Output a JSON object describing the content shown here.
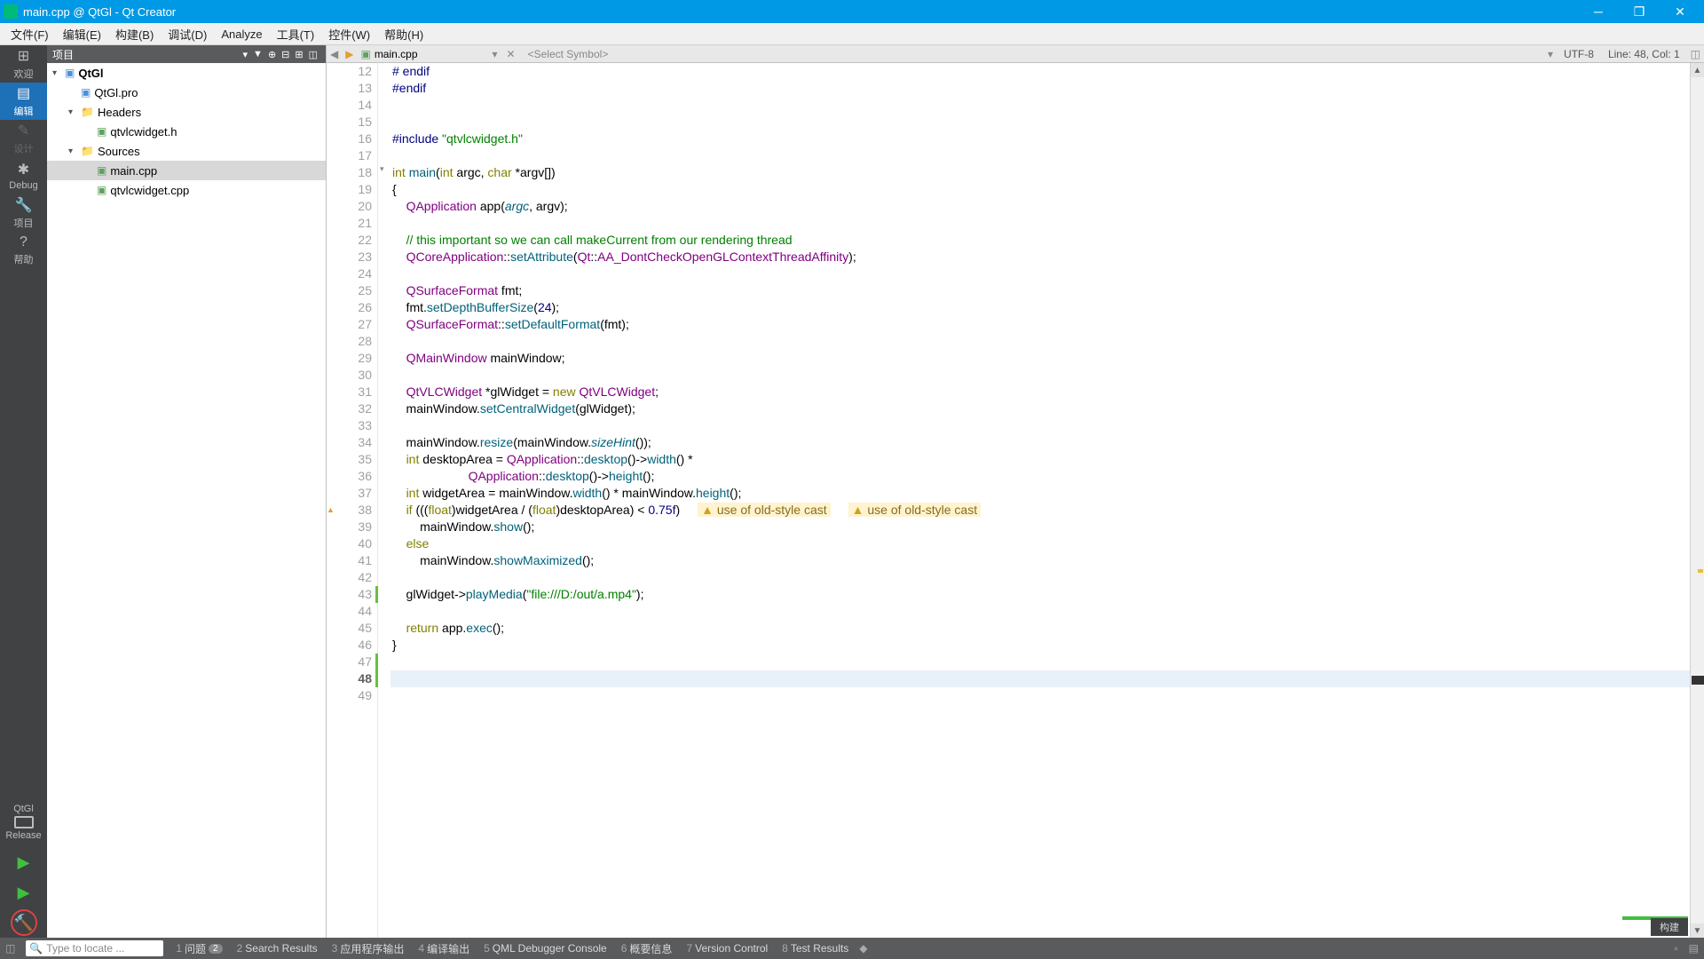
{
  "title": "main.cpp @ QtGl - Qt Creator",
  "menu": [
    "文件(F)",
    "编辑(E)",
    "构建(B)",
    "调试(D)",
    "Analyze",
    "工具(T)",
    "控件(W)",
    "帮助(H)"
  ],
  "modes": [
    {
      "icon": "⊞",
      "label": "欢迎"
    },
    {
      "icon": "▤",
      "label": "编辑"
    },
    {
      "icon": "✎",
      "label": "设计"
    },
    {
      "icon": "✱",
      "label": "Debug"
    },
    {
      "icon": "🔧",
      "label": "项目"
    },
    {
      "icon": "?",
      "label": "帮助"
    }
  ],
  "kit": {
    "name": "QtGl",
    "config": "Release"
  },
  "proj_header": "项目",
  "tree": [
    {
      "depth": 0,
      "twist": "▾",
      "ico": "proj",
      "label": "QtGl",
      "bold": true
    },
    {
      "depth": 1,
      "twist": "",
      "ico": "proj",
      "label": "QtGl.pro"
    },
    {
      "depth": 1,
      "twist": "▾",
      "ico": "folder",
      "label": "Headers"
    },
    {
      "depth": 2,
      "twist": "",
      "ico": "hdr",
      "label": "qtvlcwidget.h"
    },
    {
      "depth": 1,
      "twist": "▾",
      "ico": "folder",
      "label": "Sources"
    },
    {
      "depth": 2,
      "twist": "",
      "ico": "cpp",
      "label": "main.cpp",
      "sel": true
    },
    {
      "depth": 2,
      "twist": "",
      "ico": "cpp",
      "label": "qtvlcwidget.cpp"
    }
  ],
  "tab": {
    "file": "main.cpp",
    "symbol": "<Select Symbol>",
    "enc": "UTF-8",
    "pos": "Line: 48, Col: 1"
  },
  "first_line": 12,
  "cur_line": 48,
  "warn_lines": [
    38
  ],
  "green_ranges": [
    [
      43,
      43
    ],
    [
      47,
      48
    ]
  ],
  "warn_text": "use of old-style cast",
  "code": [
    {
      "t": [
        {
          "c": "pre",
          "s": "# endif"
        }
      ]
    },
    {
      "t": [
        {
          "c": "pre",
          "s": "#endif"
        }
      ]
    },
    {
      "t": []
    },
    {
      "t": []
    },
    {
      "t": [
        {
          "c": "pre",
          "s": "#include "
        },
        {
          "c": "str",
          "s": "\"qtvlcwidget.h\""
        }
      ]
    },
    {
      "t": []
    },
    {
      "t": [
        {
          "c": "kw",
          "s": "int"
        },
        {
          "s": " "
        },
        {
          "c": "fn",
          "s": "main"
        },
        {
          "s": "("
        },
        {
          "c": "kw",
          "s": "int"
        },
        {
          "s": " argc, "
        },
        {
          "c": "kw",
          "s": "char"
        },
        {
          "s": " *argv[])"
        }
      ],
      "fold": "▾"
    },
    {
      "t": [
        {
          "s": "{"
        }
      ]
    },
    {
      "t": [
        {
          "s": "    "
        },
        {
          "c": "typ",
          "s": "QApplication"
        },
        {
          "s": " app("
        },
        {
          "c": "fni",
          "s": "argc"
        },
        {
          "s": ", argv);"
        }
      ]
    },
    {
      "t": []
    },
    {
      "t": [
        {
          "s": "    "
        },
        {
          "c": "cmt",
          "s": "// this important so we can call makeCurrent from our rendering thread"
        }
      ]
    },
    {
      "t": [
        {
          "s": "    "
        },
        {
          "c": "typ",
          "s": "QCoreApplication"
        },
        {
          "s": "::"
        },
        {
          "c": "fn",
          "s": "setAttribute"
        },
        {
          "s": "("
        },
        {
          "c": "typ",
          "s": "Qt"
        },
        {
          "s": "::"
        },
        {
          "c": "enm",
          "s": "AA_DontCheckOpenGLContextThreadAffinity"
        },
        {
          "s": ");"
        }
      ]
    },
    {
      "t": []
    },
    {
      "t": [
        {
          "s": "    "
        },
        {
          "c": "typ",
          "s": "QSurfaceFormat"
        },
        {
          "s": " fmt;"
        }
      ]
    },
    {
      "t": [
        {
          "s": "    fmt."
        },
        {
          "c": "fn",
          "s": "setDepthBufferSize"
        },
        {
          "s": "("
        },
        {
          "c": "num",
          "s": "24"
        },
        {
          "s": ");"
        }
      ]
    },
    {
      "t": [
        {
          "s": "    "
        },
        {
          "c": "typ",
          "s": "QSurfaceFormat"
        },
        {
          "s": "::"
        },
        {
          "c": "fn",
          "s": "setDefaultFormat"
        },
        {
          "s": "(fmt);"
        }
      ]
    },
    {
      "t": []
    },
    {
      "t": [
        {
          "s": "    "
        },
        {
          "c": "typ",
          "s": "QMainWindow"
        },
        {
          "s": " mainWindow;"
        }
      ]
    },
    {
      "t": []
    },
    {
      "t": [
        {
          "s": "    "
        },
        {
          "c": "typ",
          "s": "QtVLCWidget"
        },
        {
          "s": " *glWidget = "
        },
        {
          "c": "kw",
          "s": "new"
        },
        {
          "s": " "
        },
        {
          "c": "typ",
          "s": "QtVLCWidget"
        },
        {
          "s": ";"
        }
      ]
    },
    {
      "t": [
        {
          "s": "    mainWindow."
        },
        {
          "c": "fn",
          "s": "setCentralWidget"
        },
        {
          "s": "(glWidget);"
        }
      ]
    },
    {
      "t": []
    },
    {
      "t": [
        {
          "s": "    mainWindow."
        },
        {
          "c": "fn",
          "s": "resize"
        },
        {
          "s": "(mainWindow."
        },
        {
          "c": "fni",
          "s": "sizeHint"
        },
        {
          "s": "());"
        }
      ]
    },
    {
      "t": [
        {
          "s": "    "
        },
        {
          "c": "kw",
          "s": "int"
        },
        {
          "s": " desktopArea = "
        },
        {
          "c": "typ",
          "s": "QApplication"
        },
        {
          "s": "::"
        },
        {
          "c": "fn",
          "s": "desktop"
        },
        {
          "s": "()->"
        },
        {
          "c": "fn",
          "s": "width"
        },
        {
          "s": "() *"
        }
      ]
    },
    {
      "t": [
        {
          "s": "                      "
        },
        {
          "c": "typ",
          "s": "QApplication"
        },
        {
          "s": "::"
        },
        {
          "c": "fn",
          "s": "desktop"
        },
        {
          "s": "()->"
        },
        {
          "c": "fn",
          "s": "height"
        },
        {
          "s": "();"
        }
      ]
    },
    {
      "t": [
        {
          "s": "    "
        },
        {
          "c": "kw",
          "s": "int"
        },
        {
          "s": " widgetArea = mainWindow."
        },
        {
          "c": "fn",
          "s": "width"
        },
        {
          "s": "() * mainWindow."
        },
        {
          "c": "fn",
          "s": "height"
        },
        {
          "s": "();"
        }
      ]
    },
    {
      "t": [
        {
          "s": "    "
        },
        {
          "c": "kw",
          "s": "if"
        },
        {
          "s": " ((("
        },
        {
          "c": "kw",
          "s": "float"
        },
        {
          "s": ")widgetArea / ("
        },
        {
          "c": "kw",
          "s": "float"
        },
        {
          "s": ")desktopArea) < "
        },
        {
          "c": "num",
          "s": "0.75f"
        },
        {
          "s": ")"
        }
      ],
      "warn2": true
    },
    {
      "t": [
        {
          "s": "        mainWindow."
        },
        {
          "c": "fn",
          "s": "show"
        },
        {
          "s": "();"
        }
      ]
    },
    {
      "t": [
        {
          "s": "    "
        },
        {
          "c": "kw",
          "s": "else"
        }
      ]
    },
    {
      "t": [
        {
          "s": "        mainWindow."
        },
        {
          "c": "fn",
          "s": "showMaximized"
        },
        {
          "s": "();"
        }
      ]
    },
    {
      "t": []
    },
    {
      "t": [
        {
          "s": "    glWidget->"
        },
        {
          "c": "fn",
          "s": "playMedia"
        },
        {
          "s": "("
        },
        {
          "c": "str",
          "s": "\"file:///D:/out/a.mp4\""
        },
        {
          "s": ");"
        }
      ]
    },
    {
      "t": []
    },
    {
      "t": [
        {
          "s": "    "
        },
        {
          "c": "kw",
          "s": "return"
        },
        {
          "s": " app."
        },
        {
          "c": "fn",
          "s": "exec"
        },
        {
          "s": "();"
        }
      ]
    },
    {
      "t": [
        {
          "s": "}"
        }
      ]
    },
    {
      "t": []
    },
    {
      "t": []
    },
    {
      "t": []
    }
  ],
  "bottom": {
    "placeholder": "Type to locate ...",
    "items": [
      {
        "n": "1",
        "l": "问题",
        "b": "2"
      },
      {
        "n": "2",
        "l": "Search Results"
      },
      {
        "n": "3",
        "l": "应用程序输出"
      },
      {
        "n": "4",
        "l": "编译输出"
      },
      {
        "n": "5",
        "l": "QML Debugger Console"
      },
      {
        "n": "6",
        "l": "概要信息"
      },
      {
        "n": "7",
        "l": "Version Control"
      },
      {
        "n": "8",
        "l": "Test Results"
      }
    ]
  },
  "build_label": "构建"
}
